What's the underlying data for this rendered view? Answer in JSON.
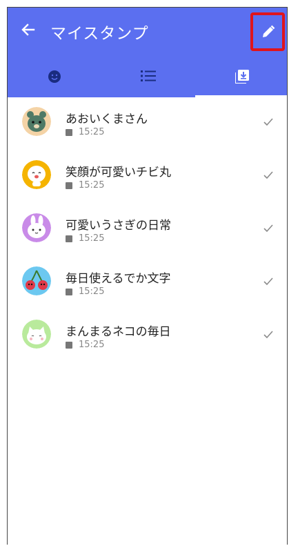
{
  "header": {
    "title": "マイスタンプ",
    "bg_color": "#5b6ff0",
    "highlight_color": "#e0141c",
    "back_icon": "arrow-left-icon",
    "edit_icon": "pencil-icon"
  },
  "tabs": [
    {
      "icon": "smiley-icon",
      "selected": false
    },
    {
      "icon": "list-icon",
      "selected": false
    },
    {
      "icon": "download-box-icon",
      "selected": true
    }
  ],
  "stickers": [
    {
      "name": "あおいくまさん",
      "time": "15:25",
      "avatar_bg": "#f4d3a6",
      "checked": true
    },
    {
      "name": "笑顔が可愛いチビ丸",
      "time": "15:25",
      "avatar_bg": "#f5b400",
      "checked": true
    },
    {
      "name": "可愛いうさぎの日常",
      "time": "15:25",
      "avatar_bg": "#c98be8",
      "checked": true
    },
    {
      "name": "毎日使えるでか文字",
      "time": "15:25",
      "avatar_bg": "#6cc8f0",
      "checked": true
    },
    {
      "name": "まんまるネコの毎日",
      "time": "15:25",
      "avatar_bg": "#b9ea9c",
      "checked": true
    }
  ]
}
